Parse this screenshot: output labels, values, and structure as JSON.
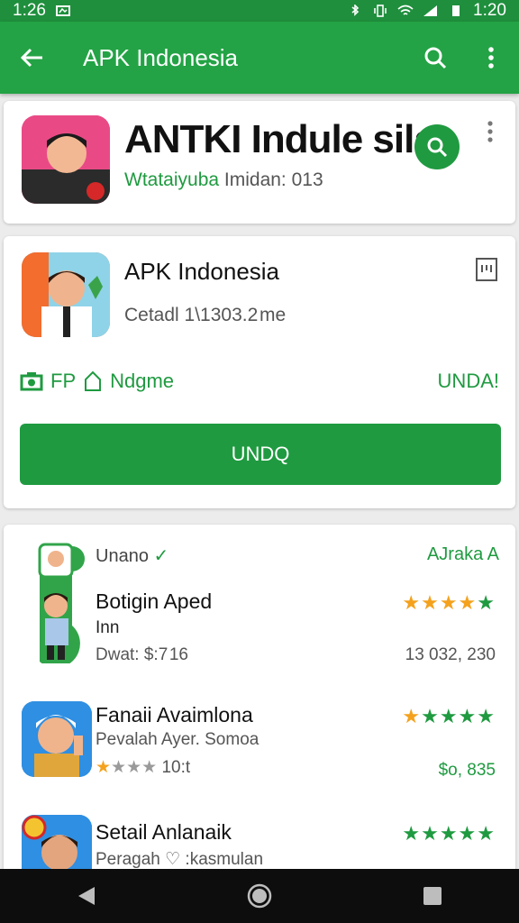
{
  "status_bar": {
    "time_left": "1:26",
    "time_right": "1:20"
  },
  "app_bar": {
    "title": "APK Indonesia"
  },
  "featured": {
    "title": "ANTKI Indule sila",
    "subtitle_green": "Wtataiyuba",
    "subtitle_rest": "Imidan: 013"
  },
  "app_card": {
    "name": "APK Indonesia",
    "detail": "Cetadl 1\\1303.2 me",
    "left_label_a": "FP",
    "left_label_b": "Ndgme",
    "right_label": "UNDA!",
    "install_label": "UNDQ"
  },
  "list": {
    "header_left": "Unano",
    "header_right": "AJraka A",
    "items": [
      {
        "title": "Botigin Aped",
        "line2": "Inn",
        "line3": "Dwat: $:7 16",
        "count": "13 032, 230",
        "stars": "★★★★★"
      },
      {
        "title": "Fanaii Avaimlona",
        "line2": "Pevalah Ayer. Somoa",
        "line3": "★★★★ 10:t",
        "count": "$o, 835",
        "stars": "★★★★★"
      },
      {
        "title": "Setail Anlanaik",
        "line2": "Peragah ♡ :kasmulan",
        "stars": "★★★★★"
      }
    ]
  },
  "colors": {
    "primary": "#23a345",
    "primary_dark": "#1f8f3d",
    "accent_green": "#1f9a40",
    "star_orange": "#f4a21e"
  }
}
